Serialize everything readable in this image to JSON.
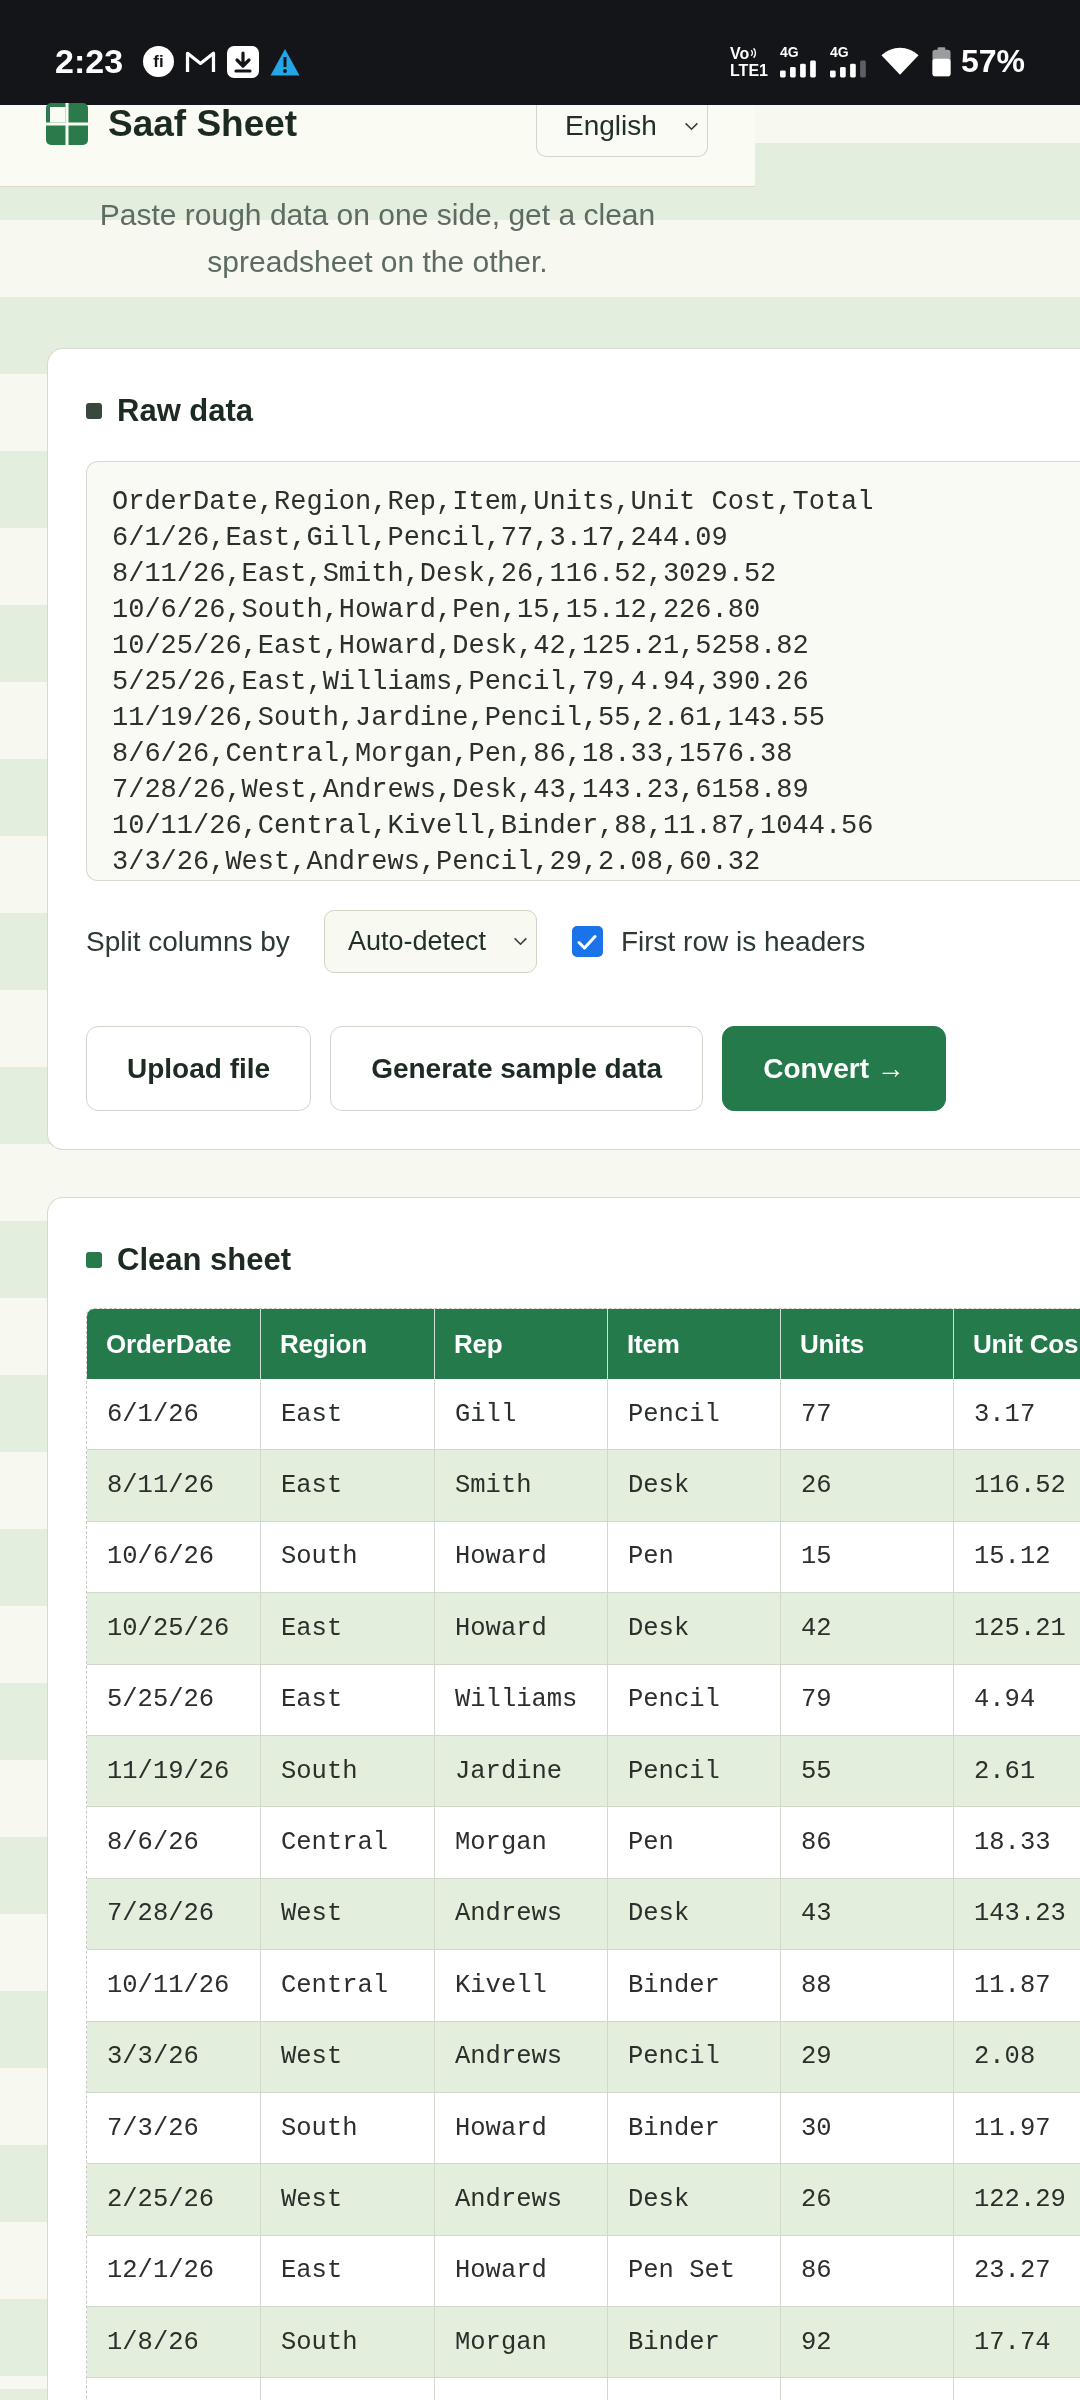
{
  "status_bar": {
    "time": "2:23",
    "notification_badge": "fi",
    "volte": "Vo",
    "lte": "LTE1",
    "network_types": [
      "4G",
      "4G"
    ],
    "battery": "57%"
  },
  "header": {
    "app_name": "Saaf Sheet",
    "language": {
      "value": "English"
    }
  },
  "tagline": "Paste rough data on one side, get a clean spreadsheet on the other.",
  "panels": [
    {
      "kind": "input",
      "title": "Raw data",
      "color": "#3a473e",
      "raw_text": {
        "value": "OrderDate,Region,Rep,Item,Units,Unit Cost,Total\n6/1/26,East,Gill,Pencil,77,3.17,244.09\n8/11/26,East,Smith,Desk,26,116.52,3029.52\n10/6/26,South,Howard,Pen,15,15.12,226.80\n10/25/26,East,Howard,Desk,42,125.21,5258.82\n5/25/26,East,Williams,Pencil,79,4.94,390.26\n11/19/26,South,Jardine,Pencil,55,2.61,143.55\n8/6/26,Central,Morgan,Pen,86,18.33,1576.38\n7/28/26,West,Andrews,Desk,43,143.23,6158.89\n10/11/26,Central,Kivell,Binder,88,11.87,1044.56\n3/3/26,West,Andrews,Pencil,29,2.08,60.32"
      },
      "split_label": "Split columns by",
      "split_select": {
        "value": "Auto-detect"
      },
      "headers_checkbox": {
        "label": "First row is headers",
        "checked": true
      },
      "buttons": [
        {
          "label": "Upload file",
          "kind": "secondary"
        },
        {
          "label": "Generate sample data",
          "kind": "secondary"
        },
        {
          "label": "Convert →",
          "kind": "primary"
        }
      ]
    },
    {
      "kind": "table",
      "title": "Clean sheet",
      "color": "#267a4b",
      "table": {
        "columns": [
          "OrderDate",
          "Region",
          "Rep",
          "Item",
          "Units",
          "Unit Cos"
        ],
        "rows": [
          [
            "6/1/26",
            "East",
            "Gill",
            "Pencil",
            "77",
            "3.17"
          ],
          [
            "8/11/26",
            "East",
            "Smith",
            "Desk",
            "26",
            "116.52"
          ],
          [
            "10/6/26",
            "South",
            "Howard",
            "Pen",
            "15",
            "15.12"
          ],
          [
            "10/25/26",
            "East",
            "Howard",
            "Desk",
            "42",
            "125.21"
          ],
          [
            "5/25/26",
            "East",
            "Williams",
            "Pencil",
            "79",
            "4.94"
          ],
          [
            "11/19/26",
            "South",
            "Jardine",
            "Pencil",
            "55",
            "2.61"
          ],
          [
            "8/6/26",
            "Central",
            "Morgan",
            "Pen",
            "86",
            "18.33"
          ],
          [
            "7/28/26",
            "West",
            "Andrews",
            "Desk",
            "43",
            "143.23"
          ],
          [
            "10/11/26",
            "Central",
            "Kivell",
            "Binder",
            "88",
            "11.87"
          ],
          [
            "3/3/26",
            "West",
            "Andrews",
            "Pencil",
            "29",
            "2.08"
          ],
          [
            "7/3/26",
            "South",
            "Howard",
            "Binder",
            "30",
            "11.97"
          ],
          [
            "2/25/26",
            "West",
            "Andrews",
            "Desk",
            "26",
            "122.29"
          ],
          [
            "12/1/26",
            "East",
            "Howard",
            "Pen Set",
            "86",
            "23.27"
          ],
          [
            "1/8/26",
            "South",
            "Morgan",
            "Binder",
            "92",
            "17.74"
          ]
        ]
      }
    }
  ]
}
